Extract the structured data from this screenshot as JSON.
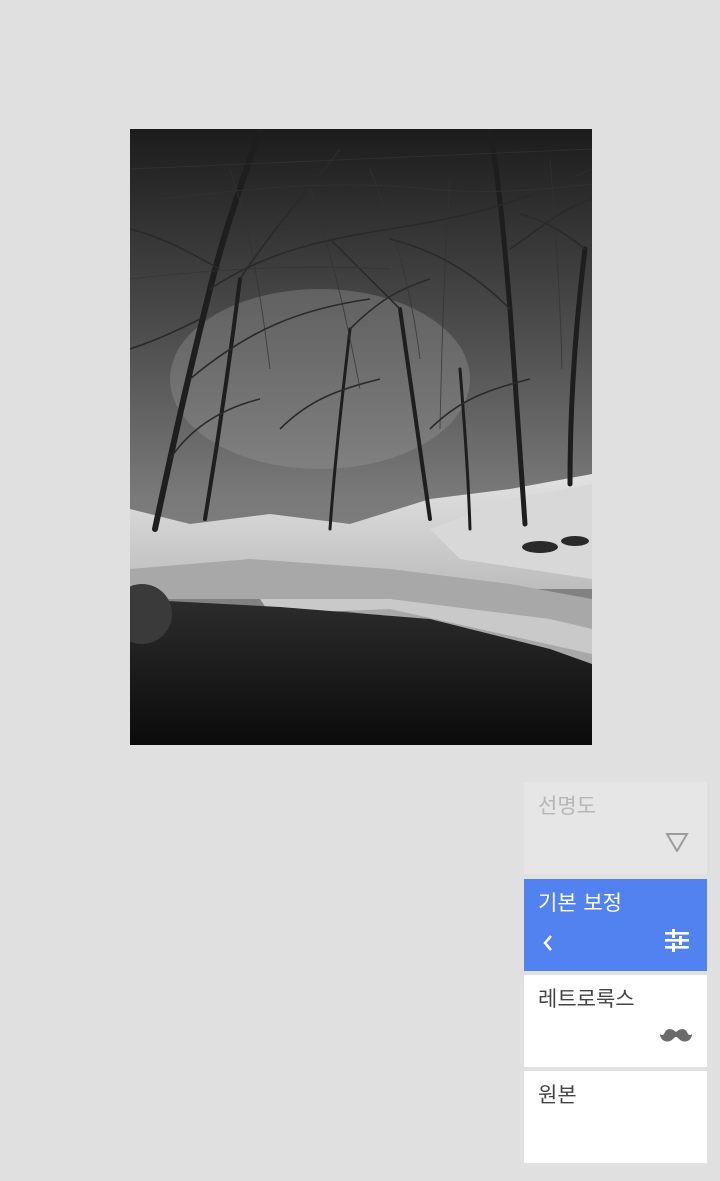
{
  "filters": {
    "sharpness": {
      "label": "선명도",
      "icon": "triangle-down-icon"
    },
    "tune_image": {
      "label": "기본 보정",
      "back_icon": "chevron-left-icon",
      "icon": "sliders-icon",
      "selected": true
    },
    "retrolux": {
      "label": "레트로룩스",
      "icon": "mustache-icon"
    },
    "original": {
      "label": "원본"
    }
  },
  "colors": {
    "background": "#e0e0e0",
    "accent": "#5282ef",
    "card_white": "#ffffff",
    "card_disabled": "#e6e6e6"
  }
}
